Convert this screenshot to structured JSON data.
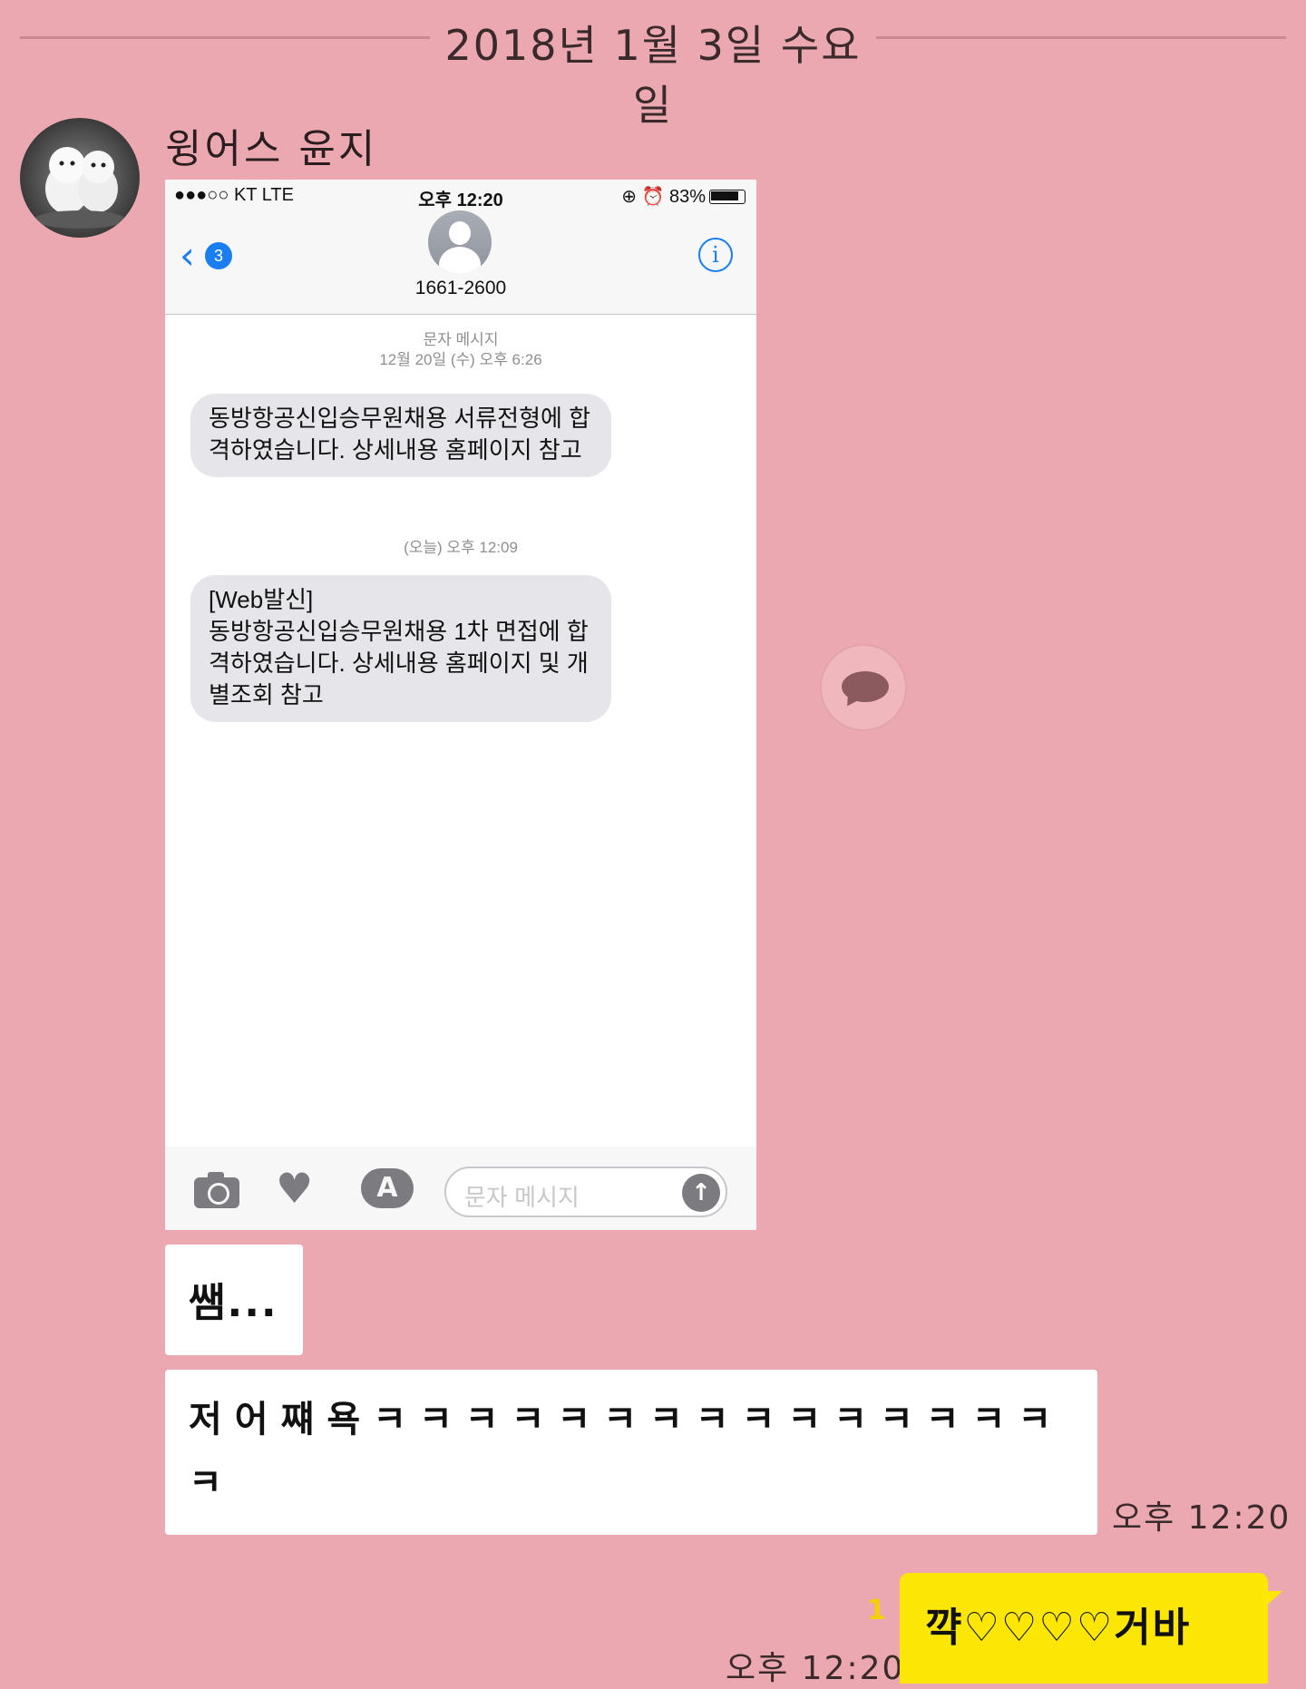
{
  "date_separator": "2018년 1월 3일 수요일",
  "sender_name": "윙어스 윤지",
  "screenshot": {
    "status": {
      "left": "●●●○○ KT  LTE",
      "time": "오후 12:20",
      "right": "⊕ ⏰ 83%"
    },
    "nav": {
      "back_glyph": "‹",
      "back_badge": "3",
      "contact_number": "1661-2600",
      "info_glyph": "i"
    },
    "thread": {
      "ts1_label": "문자 메시지",
      "ts1_time": "12월 20일 (수) 오후 6:26",
      "msg1": "동방항공신입승무원채용 서류전형에 합격하였습니다. 상세내용 홈페이지 참고",
      "ts2": "(오늘) 오후 12:09",
      "msg2_line1": "[Web발신]",
      "msg2_rest": "동방항공신입승무원채용 1차 면접에 합격하였습니다. 상세내용 홈페이지 및  개별조회 참고"
    },
    "input": {
      "placeholder": "문자 메시지",
      "appstore_glyph": "A",
      "heart_glyph": "♥",
      "send_glyph": "↑"
    }
  },
  "messages": {
    "received_1": "쌤...",
    "received_2": "저어쨰욕ㅋㅋㅋㅋㅋㅋㅋㅋㅋㅋㅋㅋㅋㅋㅋㅋ",
    "received_time": "오후 12:20",
    "sent_1": "꺅♡♡♡♡거바",
    "sent_unread": "1",
    "sent_time": "오후 12:20"
  },
  "colors": {
    "chat_background": "#eba8b0",
    "my_bubble": "#fbe605",
    "ios_blue": "#1a7df0"
  },
  "icons": {
    "share": "speech-bubble-icon",
    "avatar": "puppy-photo"
  }
}
